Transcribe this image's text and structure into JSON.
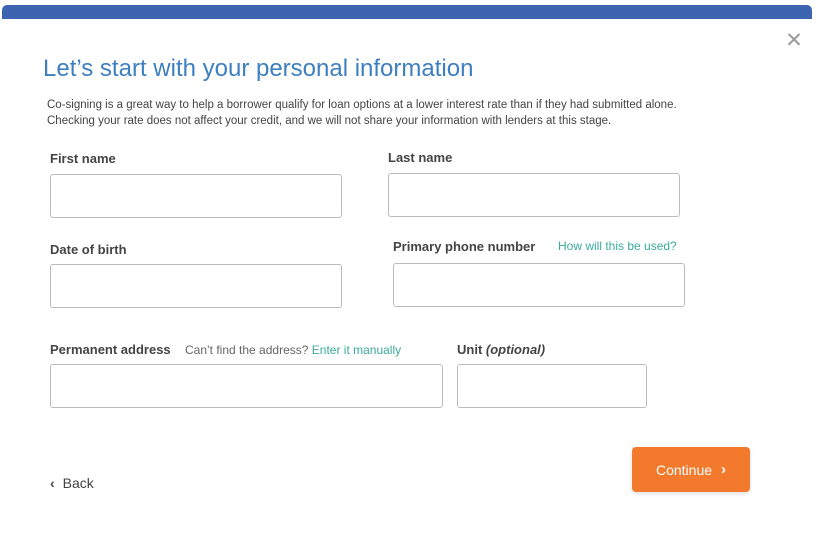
{
  "header": {
    "accent_color": "#3d64b1"
  },
  "dialog": {
    "close_icon": "close-icon",
    "title": "Let’s start with your personal information",
    "intro_line1": "Co-signing is a great way to help a borrower qualify for loan options at a lower interest rate than if they had submitted alone.",
    "intro_line2": "Checking your rate does not affect your credit, and we will not share your information with lenders at this stage."
  },
  "form": {
    "first_name": {
      "label": "First name",
      "value": ""
    },
    "last_name": {
      "label": "Last name",
      "value": ""
    },
    "dob": {
      "label": "Date of birth",
      "value": ""
    },
    "phone": {
      "label": "Primary phone number",
      "help_link": "How will this be used?",
      "value": ""
    },
    "address": {
      "label": "Permanent address",
      "hint": "Can’t find the address?",
      "manual_link": "Enter it manually",
      "value": ""
    },
    "unit": {
      "label": "Unit",
      "optional": "(optional)",
      "value": ""
    }
  },
  "footer": {
    "back_label": "Back",
    "continue_label": "Continue",
    "continue_color": "#f37a2c",
    "link_color": "#3aab9a"
  }
}
